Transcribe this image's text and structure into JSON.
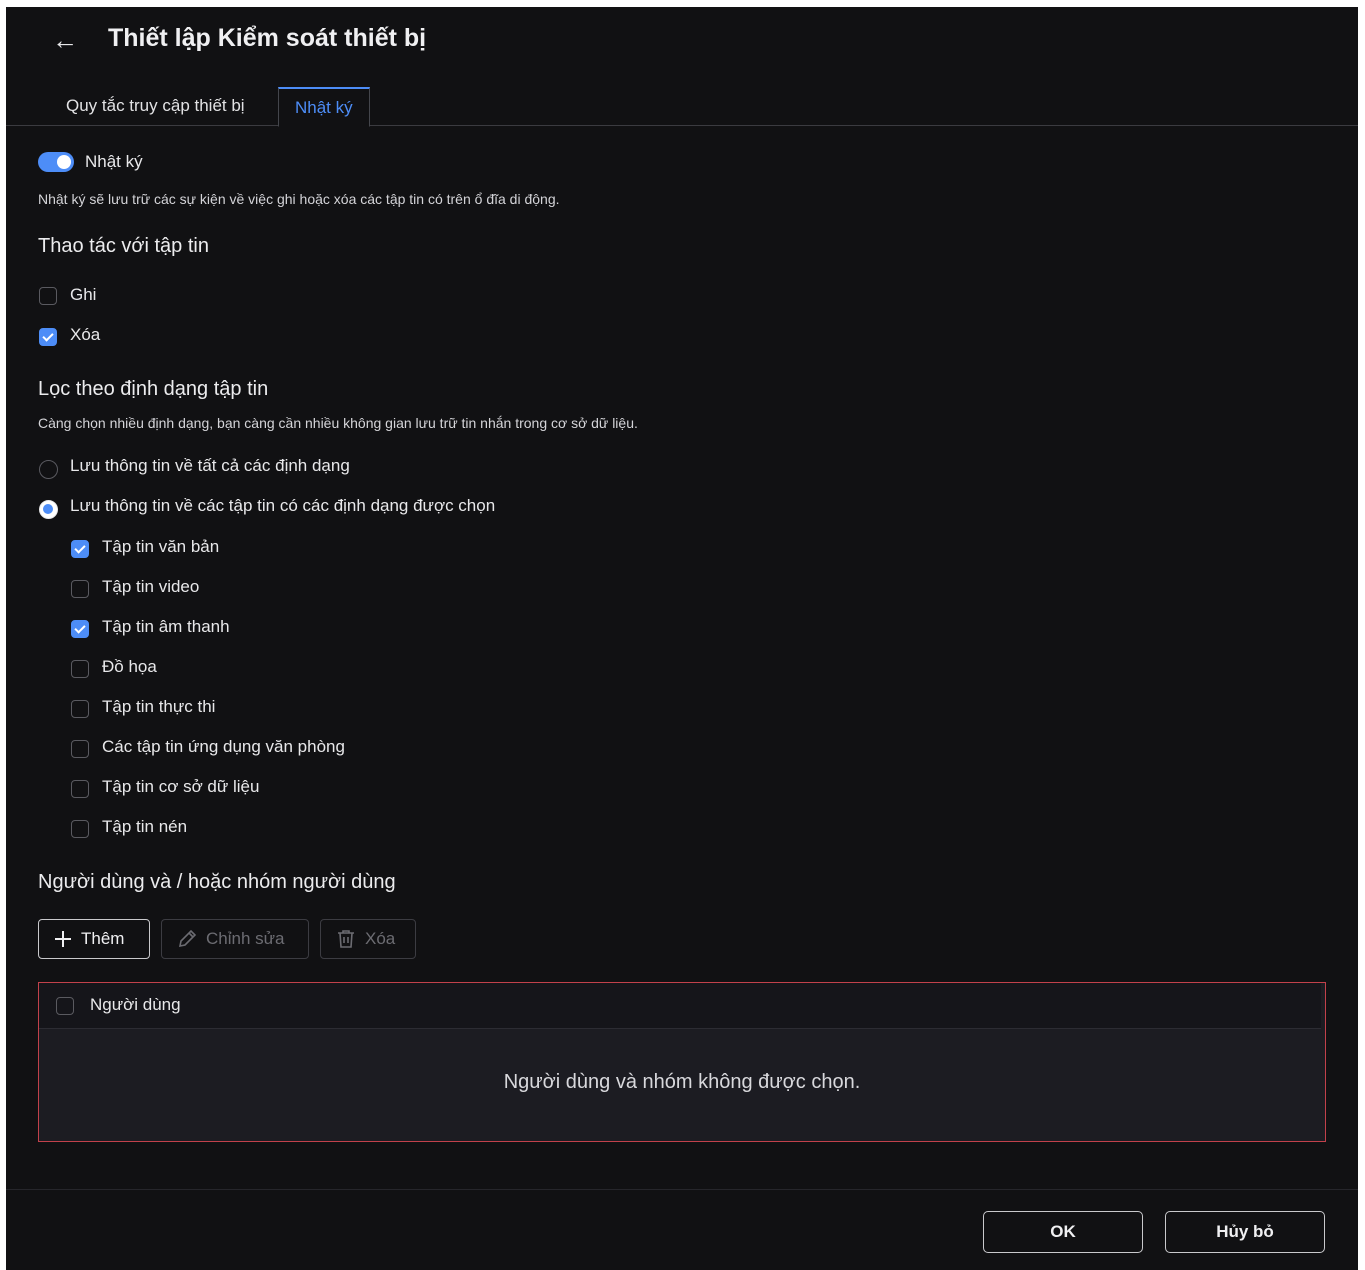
{
  "header": {
    "title": "Thiết lập Kiểm soát thiết bị"
  },
  "tabs": [
    {
      "label": "Quy tắc truy cập thiết bị",
      "active": false
    },
    {
      "label": "Nhật ký",
      "active": true
    }
  ],
  "logging": {
    "toggle_label": "Nhật ký",
    "toggle_on": true,
    "description": "Nhật ký sẽ lưu trữ các sự kiện về việc ghi hoặc xóa các tập tin có trên ổ đĩa di động."
  },
  "file_ops": {
    "heading": "Thao tác với tập tin",
    "items": [
      {
        "label": "Ghi",
        "checked": false
      },
      {
        "label": "Xóa",
        "checked": true
      }
    ]
  },
  "format_filter": {
    "heading": "Lọc theo định dạng tập tin",
    "description": "Càng chọn nhiều định dạng, bạn càng cần nhiều không gian lưu trữ tin nhắn trong cơ sở dữ liệu.",
    "radios": [
      {
        "label": "Lưu thông tin về tất cả các định dạng",
        "checked": false
      },
      {
        "label": "Lưu thông tin về các tập tin có các định dạng được chọn",
        "checked": true
      }
    ],
    "formats": [
      {
        "label": "Tập tin văn bản",
        "checked": true
      },
      {
        "label": "Tập tin video",
        "checked": false
      },
      {
        "label": "Tập tin âm thanh",
        "checked": true
      },
      {
        "label": "Đồ họa",
        "checked": false
      },
      {
        "label": "Tập tin thực thi",
        "checked": false
      },
      {
        "label": "Các tập tin ứng dụng văn phòng",
        "checked": false
      },
      {
        "label": "Tập tin cơ sở dữ liệu",
        "checked": false
      },
      {
        "label": "Tập tin nén",
        "checked": false
      }
    ]
  },
  "users": {
    "heading": "Người dùng và / hoặc nhóm người dùng",
    "add_label": "Thêm",
    "edit_label": "Chỉnh sửa",
    "delete_label": "Xóa",
    "column_header": "Người dùng",
    "empty_message": "Người dùng và nhóm không được chọn."
  },
  "footer": {
    "ok_label": "OK",
    "cancel_label": "Hủy bỏ"
  },
  "colors": {
    "accent": "#4d8df7",
    "error_border": "#c2414b",
    "background": "#111113"
  }
}
